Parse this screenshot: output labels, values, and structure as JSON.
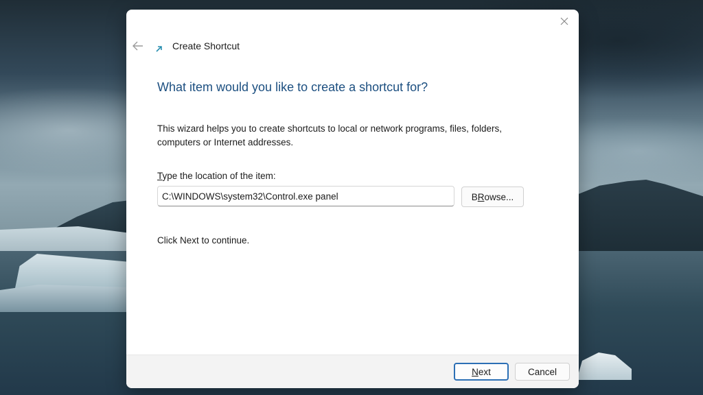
{
  "window": {
    "title": "Create Shortcut",
    "close_icon": "close-icon",
    "back_icon": "back-arrow-icon",
    "app_icon": "shortcut-icon"
  },
  "wizard": {
    "heading": "What item would you like to create a shortcut for?",
    "description": "This wizard helps you to create shortcuts to local or network programs, files, folders, computers or Internet addresses.",
    "location_label_accel": "T",
    "location_label_rest": "ype the location of the item:",
    "location_value": "C:\\WINDOWS\\system32\\Control.exe panel",
    "browse_accel": "R",
    "browse_pre": "B",
    "browse_post": "owse...",
    "hint": "Click Next to continue."
  },
  "footer": {
    "next_accel": "N",
    "next_rest": "ext",
    "cancel_label": "Cancel"
  },
  "colors": {
    "heading": "#1c4f80",
    "accent_border": "#2b6fb5"
  }
}
